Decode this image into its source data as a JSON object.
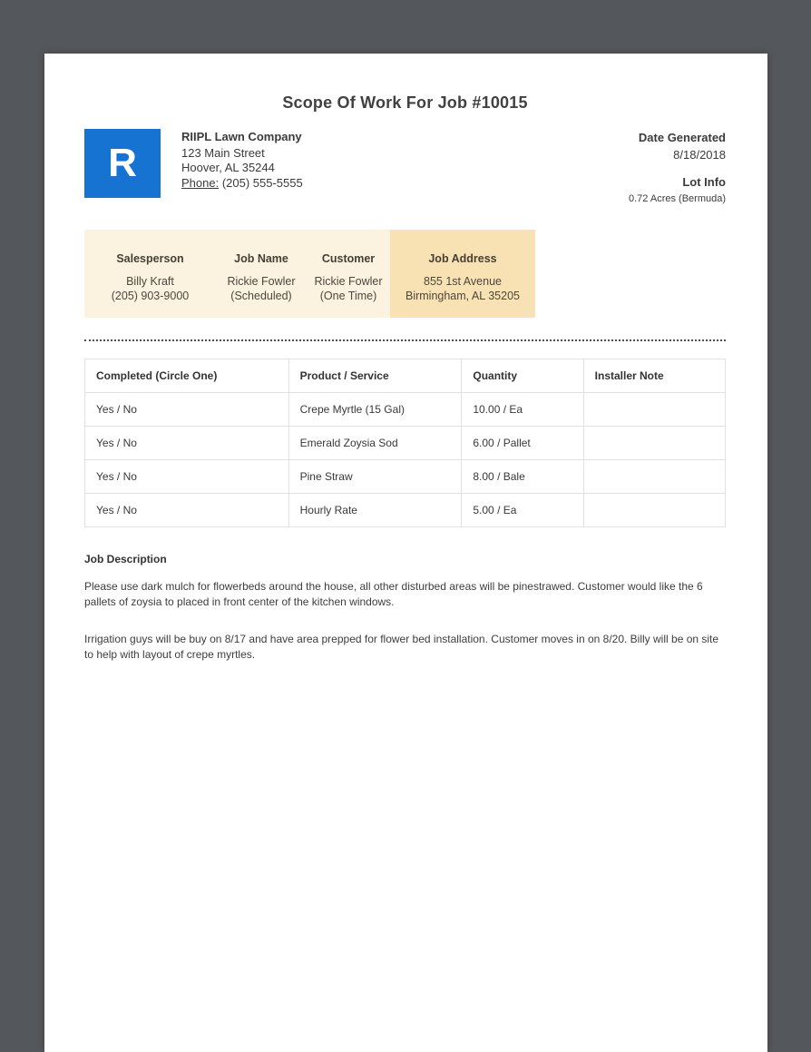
{
  "page": {
    "title": "Scope Of Work For Job #10015"
  },
  "company": {
    "logo_letter": "R",
    "logo_color": "#1673d2",
    "name": "RIIPL Lawn Company",
    "address_line1": "123 Main Street",
    "address_line2": "Hoover, AL 35244",
    "phone_label": "Phone:",
    "phone": "(205) 555-5555"
  },
  "meta": {
    "date_generated_label": "Date Generated",
    "date_generated": "8/18/2018",
    "lot_info_label": "Lot Info",
    "lot_info": "0.72 Acres (Bermuda)"
  },
  "info_bar": {
    "bg_color": "#fbf2df",
    "highlight_color": "#f8e2b4",
    "columns": [
      {
        "label": "Salesperson",
        "line1": "Billy Kraft",
        "line2": "(205) 903-9000"
      },
      {
        "label": "Job Name",
        "line1": "Rickie Fowler",
        "line2": "(Scheduled)"
      },
      {
        "label": "Customer",
        "line1": "Rickie Fowler",
        "line2": "(One Time)"
      },
      {
        "label": "Job Address",
        "line1": "855 1st Avenue",
        "line2": "Birmingham, AL 35205"
      }
    ]
  },
  "work_table": {
    "headers": [
      "Completed (Circle One)",
      "Product / Service",
      "Quantity",
      "Installer Note"
    ],
    "rows": [
      {
        "completed": "Yes / No",
        "product": "Crepe Myrtle (15 Gal)",
        "quantity": "10.00 / Ea",
        "note": ""
      },
      {
        "completed": "Yes / No",
        "product": "Emerald Zoysia Sod",
        "quantity": "6.00 / Pallet",
        "note": ""
      },
      {
        "completed": "Yes / No",
        "product": "Pine Straw",
        "quantity": "8.00 / Bale",
        "note": ""
      },
      {
        "completed": "Yes / No",
        "product": "Hourly Rate",
        "quantity": "5.00 / Ea",
        "note": ""
      }
    ]
  },
  "job_description": {
    "label": "Job Description",
    "paragraphs": [
      "Please use dark mulch for flowerbeds around the house, all other disturbed areas will be pinestrawed. Customer would like the 6 pallets of zoysia to placed in front center of the kitchen windows.",
      "Irrigation guys will be buy on 8/17 and have area prepped for flower bed installation. Customer moves in on 8/20. Billy will be on site to help with layout of crepe myrtles."
    ]
  }
}
